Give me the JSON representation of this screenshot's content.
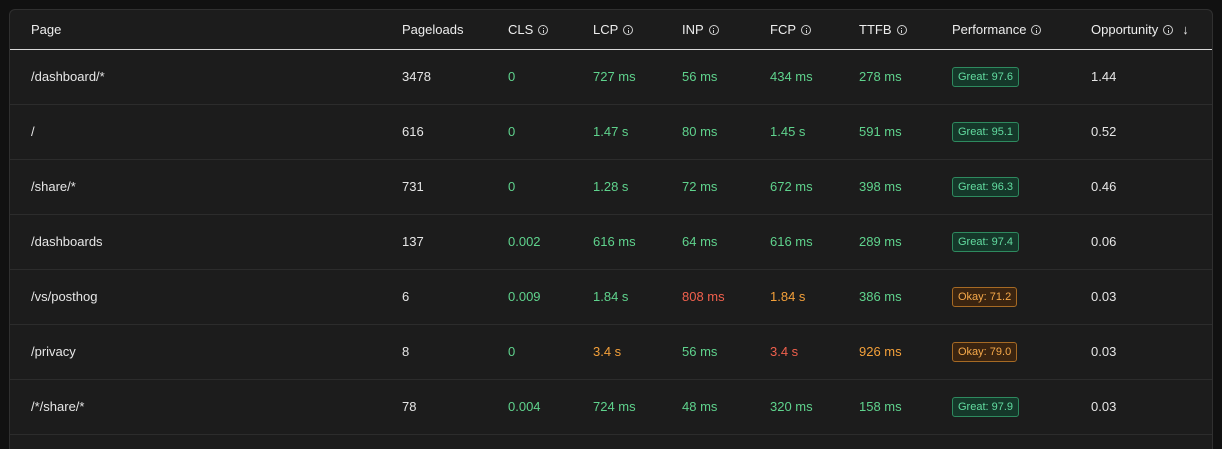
{
  "columns": {
    "page": "Page",
    "pageloads": "Pageloads",
    "cls": "CLS",
    "lcp": "LCP",
    "inp": "INP",
    "fcp": "FCP",
    "ttfb": "TTFB",
    "performance": "Performance",
    "opportunity": "Opportunity"
  },
  "sort_icon": "arrow-down-icon",
  "colors": {
    "good": "#5fd38d",
    "needs_improvement": "#f3a03a",
    "poor": "#f0604d"
  },
  "rows": [
    {
      "page": "/dashboard/*",
      "pageloads": "3478",
      "cls": "0",
      "cls_status": "good",
      "lcp": "727 ms",
      "lcp_status": "good",
      "inp": "56 ms",
      "inp_status": "good",
      "fcp": "434 ms",
      "fcp_status": "good",
      "ttfb": "278 ms",
      "ttfb_status": "good",
      "performance": "Great: 97.6",
      "performance_status": "great",
      "opportunity": "1.44"
    },
    {
      "page": "/",
      "pageloads": "616",
      "cls": "0",
      "cls_status": "good",
      "lcp": "1.47 s",
      "lcp_status": "good",
      "inp": "80 ms",
      "inp_status": "good",
      "fcp": "1.45 s",
      "fcp_status": "good",
      "ttfb": "591 ms",
      "ttfb_status": "good",
      "performance": "Great: 95.1",
      "performance_status": "great",
      "opportunity": "0.52"
    },
    {
      "page": "/share/*",
      "pageloads": "731",
      "cls": "0",
      "cls_status": "good",
      "lcp": "1.28 s",
      "lcp_status": "good",
      "inp": "72 ms",
      "inp_status": "good",
      "fcp": "672 ms",
      "fcp_status": "good",
      "ttfb": "398 ms",
      "ttfb_status": "good",
      "performance": "Great: 96.3",
      "performance_status": "great",
      "opportunity": "0.46"
    },
    {
      "page": "/dashboards",
      "pageloads": "137",
      "cls": "0.002",
      "cls_status": "good",
      "lcp": "616 ms",
      "lcp_status": "good",
      "inp": "64 ms",
      "inp_status": "good",
      "fcp": "616 ms",
      "fcp_status": "good",
      "ttfb": "289 ms",
      "ttfb_status": "good",
      "performance": "Great: 97.4",
      "performance_status": "great",
      "opportunity": "0.06"
    },
    {
      "page": "/vs/posthog",
      "pageloads": "6",
      "cls": "0.009",
      "cls_status": "good",
      "lcp": "1.84 s",
      "lcp_status": "good",
      "inp": "808 ms",
      "inp_status": "bad",
      "fcp": "1.84 s",
      "fcp_status": "warn",
      "ttfb": "386 ms",
      "ttfb_status": "good",
      "performance": "Okay: 71.2",
      "performance_status": "okay",
      "opportunity": "0.03"
    },
    {
      "page": "/privacy",
      "pageloads": "8",
      "cls": "0",
      "cls_status": "good",
      "lcp": "3.4 s",
      "lcp_status": "warn",
      "inp": "56 ms",
      "inp_status": "good",
      "fcp": "3.4 s",
      "fcp_status": "bad",
      "ttfb": "926 ms",
      "ttfb_status": "warn",
      "performance": "Okay: 79.0",
      "performance_status": "okay",
      "opportunity": "0.03"
    },
    {
      "page": "/*/share/*",
      "pageloads": "78",
      "cls": "0.004",
      "cls_status": "good",
      "lcp": "724 ms",
      "lcp_status": "good",
      "inp": "48 ms",
      "inp_status": "good",
      "fcp": "320 ms",
      "fcp_status": "good",
      "ttfb": "158 ms",
      "ttfb_status": "good",
      "performance": "Great: 97.9",
      "performance_status": "great",
      "opportunity": "0.03"
    }
  ]
}
